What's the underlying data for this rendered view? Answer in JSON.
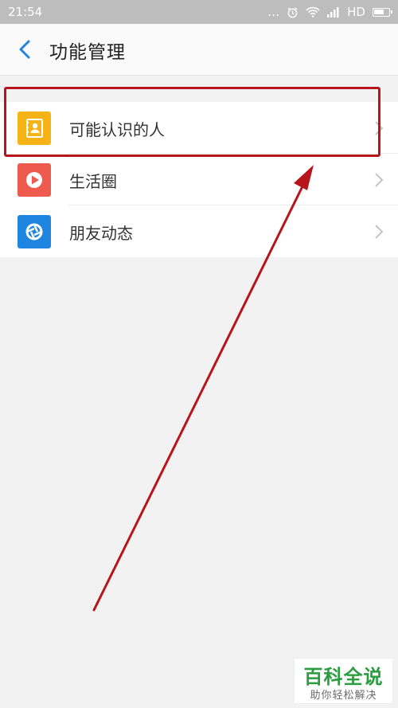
{
  "status_bar": {
    "time": "21:54",
    "dots": "…",
    "network": "HD"
  },
  "header": {
    "title": "功能管理"
  },
  "list": {
    "items": [
      {
        "label": "可能认识的人",
        "icon": "contacts-book-icon",
        "color": "#f5b316"
      },
      {
        "label": "生活圈",
        "icon": "play-circle-icon",
        "color": "#ef5a4f"
      },
      {
        "label": "朋友动态",
        "icon": "aperture-icon",
        "color": "#1e86e0"
      }
    ]
  },
  "annotation": {
    "box_color": "#b8141c",
    "arrow_color": "#b8141c"
  },
  "watermark": {
    "title": "百科全说",
    "subtitle": "助你轻松解决"
  },
  "colors": {
    "accent": "#1e86e0",
    "background": "#f2f2f2"
  }
}
